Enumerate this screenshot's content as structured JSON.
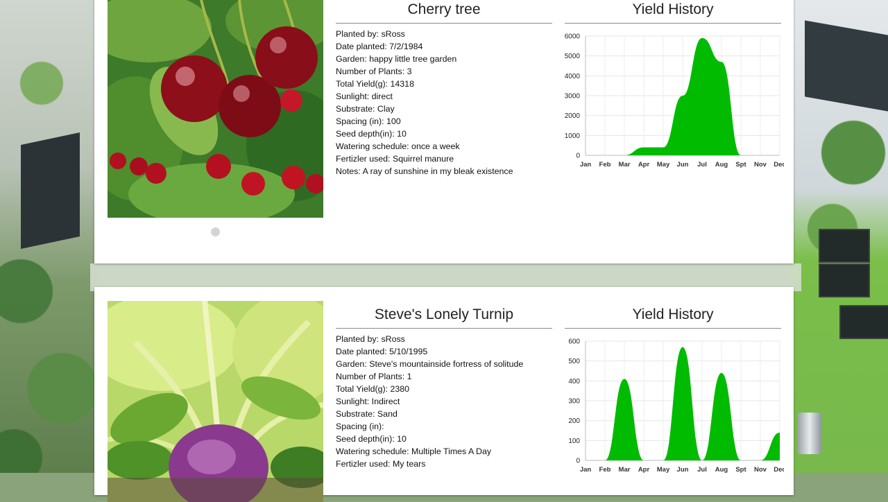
{
  "plants": [
    {
      "name": "Cherry tree",
      "fields": [
        "Planted by: sRoss",
        "Date planted: 7/2/1984",
        "Garden: happy little tree garden",
        "Number of Plants: 3",
        "Total Yield(g): 14318",
        "Sunlight: direct",
        "Substrate: Clay",
        "Spacing (in): 100",
        "Seed depth(in): 10",
        "Watering schedule: once a week",
        "Fertizler used: Squirrel manure",
        "Notes: A ray of sunshine in my bleak existence"
      ],
      "chart_title": "Yield History",
      "chart_data": {
        "type": "area",
        "title": "Yield History",
        "categories": [
          "Jan",
          "Feb",
          "Mar",
          "Apr",
          "May",
          "Jun",
          "Jul",
          "Aug",
          "Spt",
          "Nov",
          "Dec"
        ],
        "values": [
          0,
          0,
          0,
          400,
          400,
          3000,
          5900,
          4700,
          0,
          0,
          0
        ],
        "ylim": [
          0,
          6000
        ],
        "yticks": [
          0,
          1000,
          2000,
          3000,
          4000,
          5000,
          6000
        ],
        "color": "#00bb00",
        "grid": true
      }
    },
    {
      "name": "Steve's Lonely Turnip",
      "fields": [
        "Planted by: sRoss",
        "Date planted: 5/10/1995",
        "Garden: Steve's mountainside fortress of solitude",
        "Number of Plants: 1",
        "Total Yield(g): 2380",
        "Sunlight: Indirect",
        "Substrate: Sand",
        "Spacing (in):",
        "Seed depth(in): 10",
        "Watering schedule: Multiple Times A Day",
        "Fertizler used: My tears"
      ],
      "chart_title": "Yield History",
      "chart_data": {
        "type": "area",
        "title": "Yield History",
        "categories": [
          "Jan",
          "Feb",
          "Mar",
          "Apr",
          "May",
          "Jun",
          "Jul",
          "Aug",
          "Spt",
          "Nov",
          "Dec"
        ],
        "values": [
          0,
          0,
          410,
          0,
          0,
          570,
          0,
          440,
          0,
          0,
          140
        ],
        "ylim": [
          0,
          600
        ],
        "yticks": [
          0,
          100,
          200,
          300,
          400,
          500,
          600
        ],
        "color": "#00bb00",
        "grid": true
      }
    }
  ],
  "carousel_indicator": "1 of 1"
}
